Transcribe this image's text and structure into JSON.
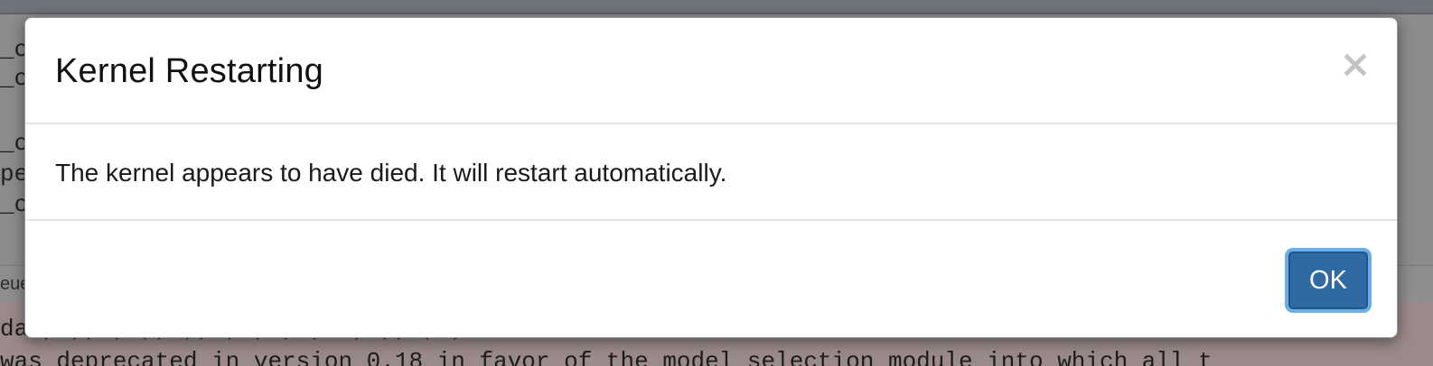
{
  "background": {
    "code_lines": [
      "_c",
      "_c",
      "_c",
      "pe",
      "_c"
    ],
    "status_text": "eue",
    "output_lines": [
      "da  ,  ,,  ,     ,,             ,,   ,        ,   ,               ,_         ,       ,,      ,  ,o",
      "was deprecated in version 0.18 in favor of the model_selection module into which all t"
    ]
  },
  "dialog": {
    "title": "Kernel Restarting",
    "close_icon": "close-icon",
    "close_glyph": "×",
    "message": "The kernel appears to have died. It will restart automatically.",
    "ok_label": "OK"
  },
  "colors": {
    "primary_button": "#2f6aa3",
    "focus_ring": "#66afe9"
  }
}
